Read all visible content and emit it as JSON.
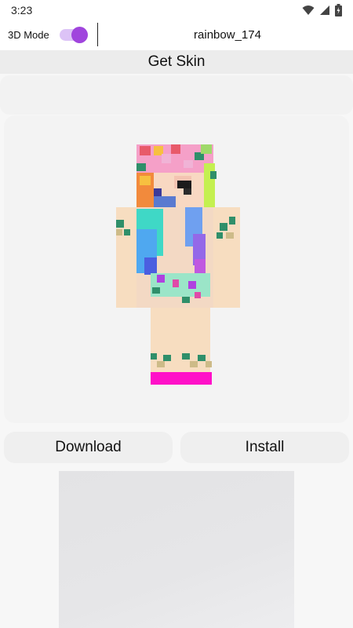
{
  "status_bar": {
    "time": "3:23",
    "icons": [
      "wifi-icon",
      "signal-icon",
      "battery-icon"
    ]
  },
  "top_bar": {
    "mode_label": "3D Mode",
    "mode_enabled": true,
    "skin_name": "rainbow_174"
  },
  "header": {
    "title": "Get Skin"
  },
  "actions": {
    "download_label": "Download",
    "install_label": "Install"
  },
  "colors": {
    "accent": "#a045dd",
    "accent_track": "#dcc3f6",
    "background": "#f7f7f7",
    "card": "#f3f3f3",
    "button": "#efefef"
  }
}
